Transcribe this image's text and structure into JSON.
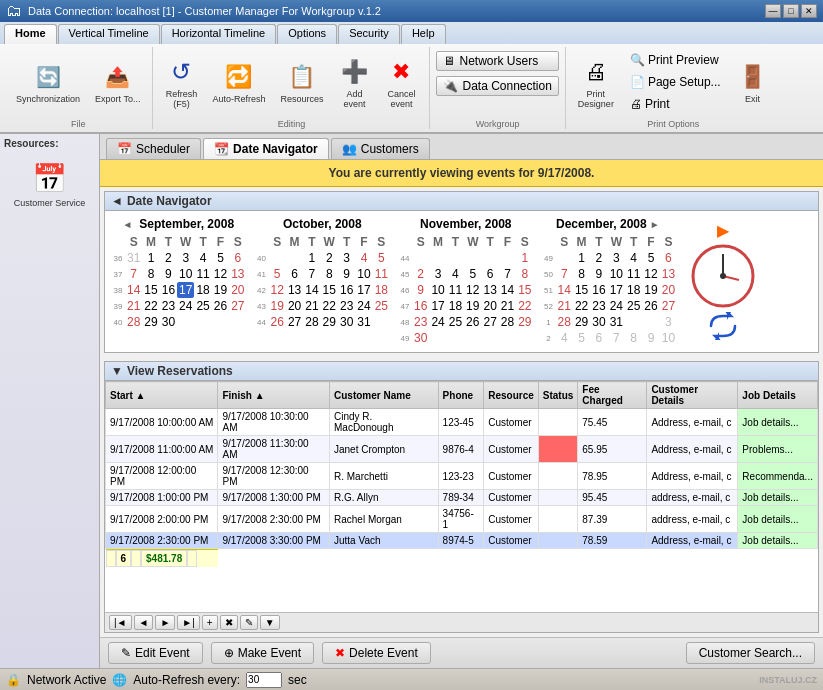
{
  "titlebar": {
    "title": "Data Connection: localhost [1] - Customer Manager For Workgroup v.1.2",
    "min": "—",
    "max": "□",
    "close": "✕"
  },
  "tabs": {
    "items": [
      "Home",
      "Vertical Timeline",
      "Horizontal Timeline",
      "Options",
      "Security",
      "Help"
    ],
    "active": 0
  },
  "toolbar": {
    "groups": {
      "file": {
        "label": "File",
        "buttons": [
          {
            "id": "synchronization",
            "label": "Synchronization",
            "icon": "🔄"
          },
          {
            "id": "export",
            "label": "Export To...",
            "icon": "📤"
          }
        ]
      },
      "editing": {
        "label": "Editing",
        "buttons": [
          {
            "id": "refresh",
            "label": "Refresh (F5)",
            "icon": "↺"
          },
          {
            "id": "auto-refresh",
            "label": "Auto-Refresh",
            "icon": "🔁"
          },
          {
            "id": "resources",
            "label": "Resources",
            "icon": "📋"
          },
          {
            "id": "add-event",
            "label": "Add event",
            "icon": "➕"
          },
          {
            "id": "cancel-event",
            "label": "Cancel event",
            "icon": "✖"
          }
        ]
      },
      "workgroup": {
        "label": "Workgroup",
        "buttons": [
          {
            "id": "network-users",
            "label": "Network Users"
          },
          {
            "id": "data-connection",
            "label": "Data Connection"
          }
        ]
      },
      "print": {
        "label": "Print Options",
        "buttons": [
          {
            "id": "print-designer",
            "label": "Print Designer"
          },
          {
            "id": "print-preview",
            "label": "Print Preview"
          },
          {
            "id": "page-setup",
            "label": "Page Setup..."
          },
          {
            "id": "print",
            "label": "Print"
          },
          {
            "id": "exit",
            "label": "Exit"
          }
        ]
      }
    }
  },
  "sidebar": {
    "title": "Resources:",
    "items": [
      {
        "id": "customer-service",
        "label": "Customer Service",
        "icon": "📅"
      }
    ]
  },
  "content_tabs": {
    "items": [
      {
        "id": "scheduler",
        "label": "Scheduler",
        "icon": "📅"
      },
      {
        "id": "date-navigator",
        "label": "Date Navigator",
        "icon": "📆"
      },
      {
        "id": "customers",
        "label": "Customers",
        "icon": "👥"
      }
    ],
    "active": 1
  },
  "info_banner": {
    "text": "You are currently viewing events for 9/17/2008."
  },
  "date_navigator": {
    "title": "Date Navigator",
    "calendars": [
      {
        "month": "September, 2008",
        "days_header": [
          "S",
          "M",
          "T",
          "W",
          "T",
          "F",
          "S"
        ],
        "weeks": [
          {
            "num": "36",
            "days": [
              {
                "d": "31",
                "prev": true
              },
              {
                "d": "1"
              },
              {
                "d": "2"
              },
              {
                "d": "3"
              },
              {
                "d": "4"
              },
              {
                "d": "5"
              },
              {
                "d": "6",
                "weekend": true
              }
            ]
          },
          {
            "num": "37",
            "days": [
              {
                "d": "7",
                "weekend": true
              },
              {
                "d": "8"
              },
              {
                "d": "9"
              },
              {
                "d": "10"
              },
              {
                "d": "11"
              },
              {
                "d": "12"
              },
              {
                "d": "13",
                "weekend": true
              }
            ]
          },
          {
            "num": "38",
            "days": [
              {
                "d": "14",
                "weekend": true
              },
              {
                "d": "15"
              },
              {
                "d": "16"
              },
              {
                "d": "17",
                "today": true
              },
              {
                "d": "18"
              },
              {
                "d": "19"
              },
              {
                "d": "20",
                "weekend": true
              }
            ]
          },
          {
            "num": "39",
            "days": [
              {
                "d": "21",
                "weekend": true
              },
              {
                "d": "22"
              },
              {
                "d": "23"
              },
              {
                "d": "24"
              },
              {
                "d": "25"
              },
              {
                "d": "26"
              },
              {
                "d": "27",
                "weekend": true
              }
            ]
          },
          {
            "num": "40",
            "days": [
              {
                "d": "28",
                "weekend": true
              },
              {
                "d": "29"
              },
              {
                "d": "30"
              },
              {
                "d": ""
              },
              {
                "d": ""
              },
              {
                "d": ""
              },
              {
                "d": ""
              }
            ]
          }
        ]
      },
      {
        "month": "October, 2008",
        "days_header": [
          "S",
          "M",
          "T",
          "W",
          "T",
          "F",
          "S"
        ],
        "weeks": [
          {
            "num": "40",
            "days": [
              {
                "d": ""
              },
              {
                "d": ""
              },
              {
                "d": "1"
              },
              {
                "d": "2"
              },
              {
                "d": "3"
              },
              {
                "d": "4",
                "weekend": true
              },
              {
                "d": "5",
                "weekend": true
              }
            ]
          },
          {
            "num": "41",
            "days": [
              {
                "d": "5",
                "weekend": true
              },
              {
                "d": "6"
              },
              {
                "d": "7"
              },
              {
                "d": "8"
              },
              {
                "d": "9"
              },
              {
                "d": "10"
              },
              {
                "d": "11",
                "weekend": true
              }
            ]
          },
          {
            "num": "42",
            "days": [
              {
                "d": "12",
                "weekend": true
              },
              {
                "d": "13"
              },
              {
                "d": "14"
              },
              {
                "d": "15"
              },
              {
                "d": "16"
              },
              {
                "d": "17"
              },
              {
                "d": "18",
                "weekend": true
              }
            ]
          },
          {
            "num": "43",
            "days": [
              {
                "d": "19",
                "weekend": true
              },
              {
                "d": "20"
              },
              {
                "d": "21"
              },
              {
                "d": "22"
              },
              {
                "d": "23"
              },
              {
                "d": "24"
              },
              {
                "d": "25",
                "weekend": true
              }
            ]
          },
          {
            "num": "44",
            "days": [
              {
                "d": "26",
                "weekend": true
              },
              {
                "d": "27"
              },
              {
                "d": "28"
              },
              {
                "d": "29"
              },
              {
                "d": "30"
              },
              {
                "d": "31"
              },
              {
                "d": ""
              }
            ]
          }
        ]
      },
      {
        "month": "November, 2008",
        "days_header": [
          "S",
          "M",
          "T",
          "W",
          "T",
          "F",
          "S"
        ],
        "weeks": [
          {
            "num": "44",
            "days": [
              {
                "d": ""
              },
              {
                "d": ""
              },
              {
                "d": ""
              },
              {
                "d": ""
              },
              {
                "d": ""
              },
              {
                "d": ""
              },
              {
                "d": "1",
                "weekend": true
              }
            ]
          },
          {
            "num": "45",
            "days": [
              {
                "d": "2",
                "weekend": true
              },
              {
                "d": "3"
              },
              {
                "d": "4"
              },
              {
                "d": "5"
              },
              {
                "d": "6"
              },
              {
                "d": "7"
              },
              {
                "d": "8",
                "weekend": true
              }
            ]
          },
          {
            "num": "46",
            "days": [
              {
                "d": "9",
                "weekend": true
              },
              {
                "d": "10"
              },
              {
                "d": "11"
              },
              {
                "d": "12"
              },
              {
                "d": "13"
              },
              {
                "d": "14"
              },
              {
                "d": "15",
                "weekend": true
              }
            ]
          },
          {
            "num": "47",
            "days": [
              {
                "d": "16",
                "weekend": true
              },
              {
                "d": "17"
              },
              {
                "d": "18"
              },
              {
                "d": "19"
              },
              {
                "d": "20"
              },
              {
                "d": "21"
              },
              {
                "d": "22",
                "weekend": true
              }
            ]
          },
          {
            "num": "48",
            "days": [
              {
                "d": "23",
                "weekend": true
              },
              {
                "d": "24"
              },
              {
                "d": "25"
              },
              {
                "d": "26"
              },
              {
                "d": "27"
              },
              {
                "d": "28"
              },
              {
                "d": "29",
                "weekend": true
              }
            ]
          },
          {
            "num": "49",
            "days": [
              {
                "d": "30",
                "weekend": true
              },
              {
                "d": ""
              },
              {
                "d": ""
              },
              {
                "d": ""
              },
              {
                "d": ""
              },
              {
                "d": ""
              },
              {
                "d": ""
              }
            ]
          }
        ]
      },
      {
        "month": "December, 2008",
        "days_header": [
          "S",
          "M",
          "T",
          "W",
          "T",
          "F",
          "S"
        ],
        "weeks": [
          {
            "num": "49",
            "days": [
              {
                "d": ""
              },
              {
                "d": "1"
              },
              {
                "d": "2"
              },
              {
                "d": "3"
              },
              {
                "d": "4"
              },
              {
                "d": "5"
              },
              {
                "d": "6",
                "weekend": true
              }
            ]
          },
          {
            "num": "50",
            "days": [
              {
                "d": "7",
                "weekend": true
              },
              {
                "d": "8"
              },
              {
                "d": "9"
              },
              {
                "d": "10"
              },
              {
                "d": "11"
              },
              {
                "d": "12"
              },
              {
                "d": "13",
                "weekend": true
              }
            ]
          },
          {
            "num": "51",
            "days": [
              {
                "d": "14",
                "weekend": true
              },
              {
                "d": "15"
              },
              {
                "d": "16"
              },
              {
                "d": "17"
              },
              {
                "d": "18"
              },
              {
                "d": "19"
              },
              {
                "d": "20",
                "weekend": true
              }
            ]
          },
          {
            "num": "52",
            "days": [
              {
                "d": "21",
                "weekend": true
              },
              {
                "d": "22"
              },
              {
                "d": "23"
              },
              {
                "d": "24"
              },
              {
                "d": "25"
              },
              {
                "d": "26"
              },
              {
                "d": "27",
                "weekend": true
              }
            ]
          },
          {
            "num": "1",
            "days": [
              {
                "d": "28",
                "weekend": true
              },
              {
                "d": "29"
              },
              {
                "d": "30"
              },
              {
                "d": "31"
              },
              {
                "d": ""
              },
              {
                "d": ""
              },
              {
                "d": "3",
                "next": true
              }
            ]
          },
          {
            "num": "2",
            "days": [
              {
                "d": "4",
                "next": true
              },
              {
                "d": "5",
                "next": true
              },
              {
                "d": "6",
                "next": true
              },
              {
                "d": "7",
                "next": true
              },
              {
                "d": "8",
                "next": true
              },
              {
                "d": "9",
                "next": true
              },
              {
                "d": "10",
                "next": true
              }
            ]
          }
        ]
      }
    ]
  },
  "reservations": {
    "title": "View Reservations",
    "columns": [
      "Start",
      "Finish",
      "Customer Name",
      "Phone",
      "Resource",
      "Status",
      "Fee Charged",
      "Customer Details",
      "Job Details"
    ],
    "rows": [
      {
        "start": "9/17/2008 10:00:00 AM",
        "finish": "9/17/2008 10:30:00 AM",
        "customer": "Cindy R. MacDonough",
        "phone": "123-45",
        "resource": "Customer",
        "status": "",
        "fee": "75.45",
        "details": "Address, e-mail, c",
        "job": "Job details..."
      },
      {
        "start": "9/17/2008 11:00:00 AM",
        "finish": "9/17/2008 11:30:00 AM",
        "customer": "Janet Crompton",
        "phone": "9876-4",
        "resource": "Customer",
        "status": "red",
        "fee": "65.95",
        "details": "Address, e-mail, c",
        "job": "Problems..."
      },
      {
        "start": "9/17/2008 12:00:00 PM",
        "finish": "9/17/2008 12:30:00 PM",
        "customer": "R. Marchetti",
        "phone": "123-23",
        "resource": "Customer",
        "status": "",
        "fee": "78.95",
        "details": "Address, e-mail, c",
        "job": "Recommenda..."
      },
      {
        "start": "9/17/2008 1:00:00 PM",
        "finish": "9/17/2008 1:30:00 PM",
        "customer": "R.G. Allyn",
        "phone": "789-34",
        "resource": "Customer",
        "status": "",
        "fee": "95.45",
        "details": "address, e-mail, c",
        "job": "Job details..."
      },
      {
        "start": "9/17/2008 2:00:00 PM",
        "finish": "9/17/2008 2:30:00 PM",
        "customer": "Rachel Morgan",
        "phone": "34756-1",
        "resource": "Customer",
        "status": "",
        "fee": "87.39",
        "details": "address, e-mail, c",
        "job": "Job details..."
      },
      {
        "start": "9/17/2008 2:30:00 PM",
        "finish": "9/17/2008 3:30:00 PM",
        "customer": "Jutta Vach",
        "phone": "8974-5",
        "resource": "Customer",
        "status": "",
        "fee": "78.59",
        "details": "Address, e-mail, c",
        "job": "Job details..."
      }
    ],
    "footer": {
      "count": "6",
      "total": "$481.78"
    }
  },
  "action_buttons": {
    "edit": "✎ Edit Event",
    "make": "⊕ Make Event",
    "delete": "✖ Delete Event",
    "search": "Customer Search..."
  },
  "statusbar": {
    "network": "Network Active",
    "auto_refresh": "Auto-Refresh every:",
    "interval": "30",
    "unit": "sec"
  },
  "watermark": "INSTALUJ.CZ"
}
